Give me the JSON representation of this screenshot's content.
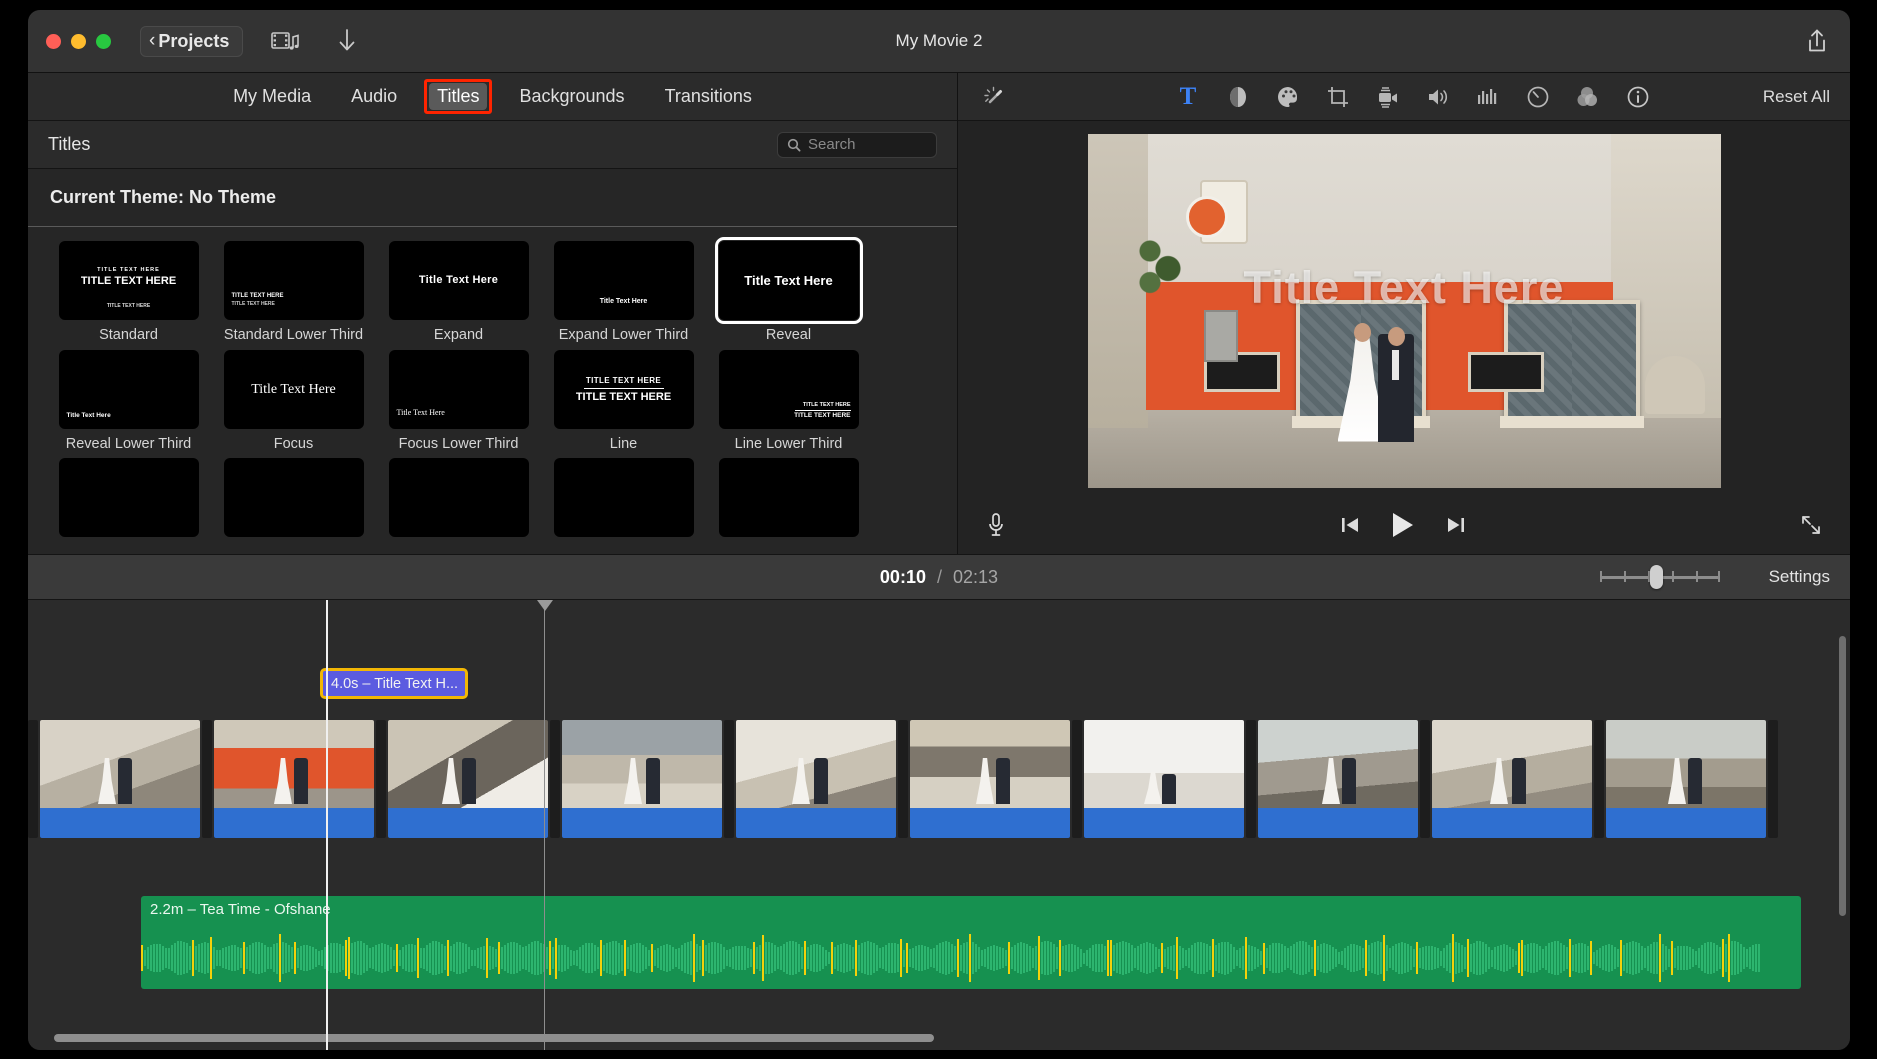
{
  "window": {
    "title": "My Movie 2",
    "back_button": "Projects",
    "traffic_lights": [
      "close-button",
      "minimize-button",
      "zoom-button"
    ],
    "media_icon": "film-music-icon",
    "import_icon": "import-download-icon",
    "share_icon": "share-icon"
  },
  "browser": {
    "tabs": [
      {
        "label": "My Media",
        "active": false
      },
      {
        "label": "Audio",
        "active": false
      },
      {
        "label": "Titles",
        "active": true,
        "highlighted": true
      },
      {
        "label": "Backgrounds",
        "active": false
      },
      {
        "label": "Transitions",
        "active": false
      }
    ],
    "header_title": "Titles",
    "search": {
      "placeholder": "Search",
      "value": "",
      "icon": "search-icon"
    },
    "theme_line": "Current Theme: No Theme",
    "titles": [
      {
        "name": "Standard",
        "preview_main": "TITLE TEXT HERE",
        "preview_sub": "TITLE TEXT HERE",
        "style": "sans",
        "pos": "center",
        "selected": false
      },
      {
        "name": "Standard Lower Third",
        "preview_main": "TITLE TEXT HERE",
        "preview_sub": "TITLE TEXT HERE",
        "style": "sans",
        "pos": "lower",
        "selected": false
      },
      {
        "name": "Expand",
        "preview_main": "Title Text Here",
        "preview_sub": "",
        "style": "sans",
        "pos": "center",
        "selected": false
      },
      {
        "name": "Expand Lower Third",
        "preview_main": "Title Text Here",
        "preview_sub": "",
        "style": "sans",
        "pos": "lower",
        "selected": false
      },
      {
        "name": "Reveal",
        "preview_main": "Title Text Here",
        "preview_sub": "",
        "style": "sans",
        "pos": "center",
        "selected": true
      },
      {
        "name": "Reveal Lower Third",
        "preview_main": "Title Text Here",
        "preview_sub": "",
        "style": "sans",
        "pos": "lower",
        "selected": false
      },
      {
        "name": "Focus",
        "preview_main": "Title Text Here",
        "preview_sub": "",
        "style": "serif",
        "pos": "center",
        "selected": false
      },
      {
        "name": "Focus Lower Third",
        "preview_main": "Title Text Here",
        "preview_sub": "",
        "style": "serif",
        "pos": "lower",
        "selected": false
      },
      {
        "name": "Line",
        "preview_main": "TITLE TEXT HERE",
        "preview_sub": "TITLE TEXT HERE",
        "style": "sans",
        "pos": "line",
        "selected": false
      },
      {
        "name": "Line Lower Third",
        "preview_main": "TITLE TEXT HERE",
        "preview_sub": "TITLE TEXT HERE",
        "style": "sans",
        "pos": "lineLow",
        "selected": false
      }
    ]
  },
  "viewer": {
    "tools": [
      {
        "name": "enhance-magic-wand-icon",
        "active": false
      },
      {
        "name": "title-text-icon",
        "active": true
      },
      {
        "name": "color-balance-icon",
        "active": false
      },
      {
        "name": "color-correction-icon",
        "active": false
      },
      {
        "name": "crop-icon",
        "active": false
      },
      {
        "name": "stabilization-icon",
        "active": false
      },
      {
        "name": "volume-icon",
        "active": false
      },
      {
        "name": "equalizer-noise-icon",
        "active": false
      },
      {
        "name": "speed-icon",
        "active": false
      },
      {
        "name": "filters-icon",
        "active": false
      },
      {
        "name": "info-icon",
        "active": false
      }
    ],
    "reset_all": "Reset All",
    "overlay_text": "Title Text Here",
    "controls": {
      "voiceover": "microphone-icon",
      "previous": "skip-to-start-icon",
      "play": "play-icon",
      "next": "skip-to-end-icon",
      "fullscreen": "fullscreen-icon"
    }
  },
  "timeline": {
    "current_time": "00:10",
    "separator": "/",
    "total_time": "02:13",
    "zoom_value": 50,
    "settings_label": "Settings",
    "title_clip": {
      "label": "4.0s – Title Text H...",
      "duration": "4.0s"
    },
    "audio_clip": {
      "label": "2.2m – Tea Time - Ofshane",
      "duration": "2.2m",
      "song": "Tea Time - Ofshane"
    },
    "video_clip_count": 10
  },
  "colors": {
    "accent_blue": "#3d82f5",
    "highlight_red": "#ff2400",
    "title_clip_purple": "#5b5be0",
    "title_clip_border": "#f2b705",
    "audio_green": "#169150",
    "clip_blue": "#2f6fd0"
  }
}
